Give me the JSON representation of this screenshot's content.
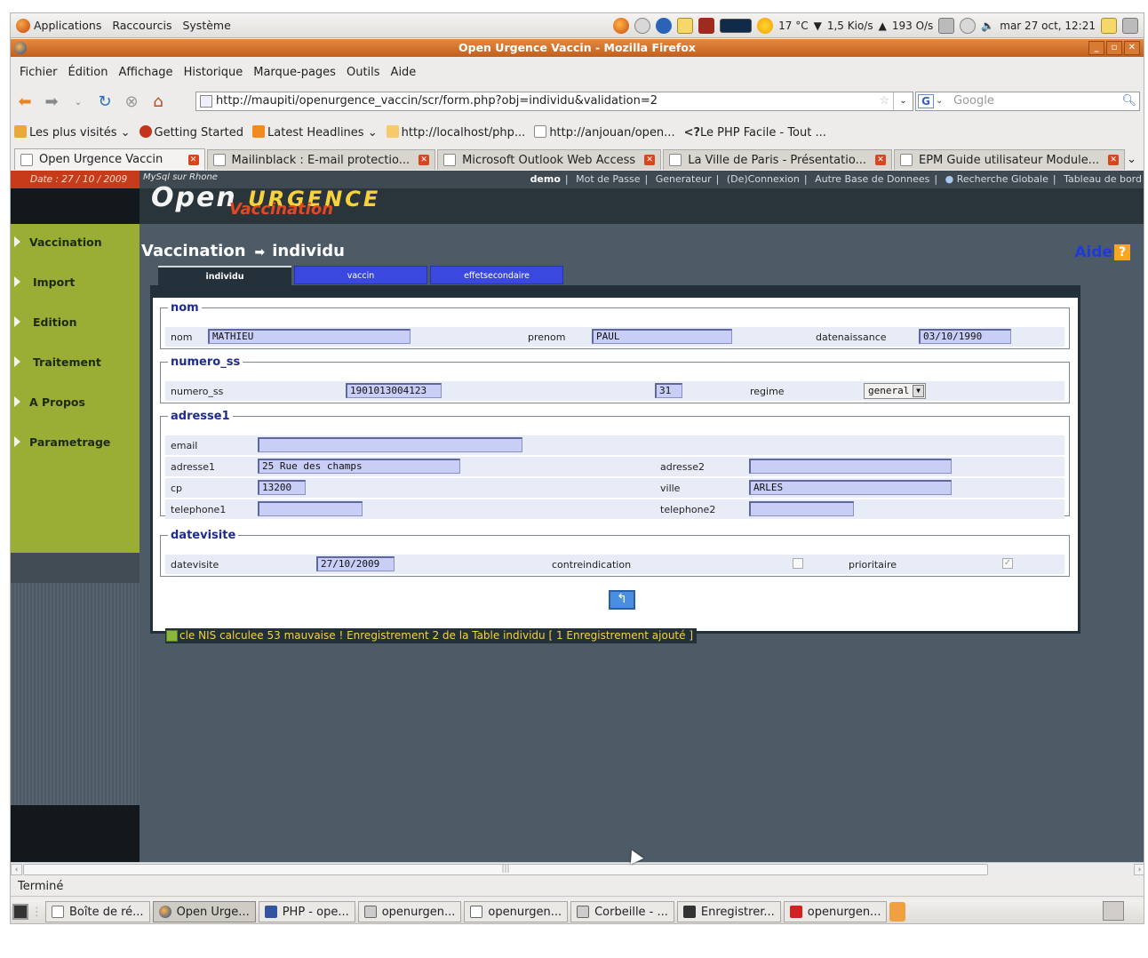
{
  "gnome_panel": {
    "menus": [
      "Applications",
      "Raccourcis",
      "Système"
    ],
    "weather": "17 °C",
    "net_down": "1,5 Kio/s",
    "net_up": "193 O/s",
    "clock": "mar 27 oct, 12:21"
  },
  "window": {
    "title": "Open Urgence Vaccin - Mozilla Firefox"
  },
  "menubar": [
    "Fichier",
    "Édition",
    "Affichage",
    "Historique",
    "Marque-pages",
    "Outils",
    "Aide"
  ],
  "navbar": {
    "url": "http://maupiti/openurgence_vaccin/scr/form.php?obj=individu&validation=2",
    "search_placeholder": "Google"
  },
  "bookmarks": [
    {
      "label": "Les plus visités",
      "icon": "folder-icon",
      "dropdown": true
    },
    {
      "label": "Getting Started",
      "icon": "firefox-icon",
      "dropdown": false
    },
    {
      "label": "Latest Headlines",
      "icon": "rss-icon",
      "dropdown": true
    },
    {
      "label": "http://localhost/php...",
      "icon": "phpmyadmin-icon",
      "dropdown": false
    },
    {
      "label": "http://anjouan/open...",
      "icon": "page-icon",
      "dropdown": false
    },
    {
      "label": "Le PHP Facile - Tout ...",
      "icon": "php-icon",
      "dropdown": false
    }
  ],
  "tabs": [
    {
      "label": "Open Urgence Vaccin",
      "active": true
    },
    {
      "label": "Mailinblack : E-mail protectio...",
      "active": false
    },
    {
      "label": "Microsoft Outlook Web Access",
      "active": false
    },
    {
      "label": "La Ville de Paris - Présentatio...",
      "active": false
    },
    {
      "label": "EPM Guide utilisateur Module...",
      "active": false
    }
  ],
  "app": {
    "date_strip": "Date : 27 / 10 / 2009",
    "db_label": "MySql sur Rhone",
    "logo_open": "Open",
    "logo_urgence": "URGENCE",
    "logo_vaccination": "Vaccination",
    "top_links": {
      "user": "demo",
      "items": [
        "Mot de Passe",
        "Generateur",
        "(De)Connexion",
        "Autre Base de Donnees",
        "Recherche Globale",
        "Tableau de bord"
      ]
    },
    "sidebar": [
      "Vaccination",
      "Import",
      "Edition",
      "Traitement",
      "A Propos",
      "Parametrage"
    ],
    "page_title_left": "Vaccination",
    "page_title_right": "individu",
    "aide": "Aide",
    "aide_q": "?",
    "form_tabs": [
      "individu",
      "vaccin",
      "effetsecondaire"
    ],
    "status_message": "cle NIS calculee 53 mauvaise  !    Enregistrement 2 de la Table individu [ 1 Enregistrement ajouté ]"
  },
  "form": {
    "nom": {
      "legend": "nom",
      "nom_label": "nom",
      "nom_value": "MATHIEU",
      "prenom_label": "prenom",
      "prenom_value": "PAUL",
      "datenaissance_label": "datenaissance",
      "datenaissance_value": "03/10/1990"
    },
    "numero_ss": {
      "legend": "numero_ss",
      "numero_ss_label": "numero_ss",
      "numero_ss_value": "1901013004123",
      "cle_value": "31",
      "regime_label": "regime",
      "regime_value": "general"
    },
    "adresse1": {
      "legend": "adresse1",
      "email_label": "email",
      "email_value": "",
      "adresse1_label": "adresse1",
      "adresse1_value": "25 Rue des champs",
      "adresse2_label": "adresse2",
      "adresse2_value": "",
      "cp_label": "cp",
      "cp_value": "13200",
      "ville_label": "ville",
      "ville_value": "ARLES",
      "telephone1_label": "telephone1",
      "telephone1_value": "",
      "telephone2_label": "telephone2",
      "telephone2_value": ""
    },
    "datevisite": {
      "legend": "datevisite",
      "datevisite_label": "datevisite",
      "datevisite_value": "27/10/2009",
      "contreindication_label": "contreindication",
      "contreindication_checked": false,
      "prioritaire_label": "prioritaire",
      "prioritaire_checked": true
    }
  },
  "statusbar": "Terminé",
  "taskbar": [
    {
      "label": "Boîte de ré...",
      "icon": "mail-icon",
      "active": false
    },
    {
      "label": "Open Urge...",
      "icon": "firefox-icon",
      "active": true
    },
    {
      "label": "PHP - ope...",
      "icon": "php-icon",
      "active": false
    },
    {
      "label": "openurgen...",
      "icon": "folder-icon",
      "active": false
    },
    {
      "label": "openurgen...",
      "icon": "document-icon",
      "active": false
    },
    {
      "label": "Corbeille - ...",
      "icon": "trash-icon",
      "active": false
    },
    {
      "label": "Enregistrer...",
      "icon": "camera-icon",
      "active": false
    },
    {
      "label": "openurgen...",
      "icon": "pdf-icon",
      "active": false
    }
  ]
}
